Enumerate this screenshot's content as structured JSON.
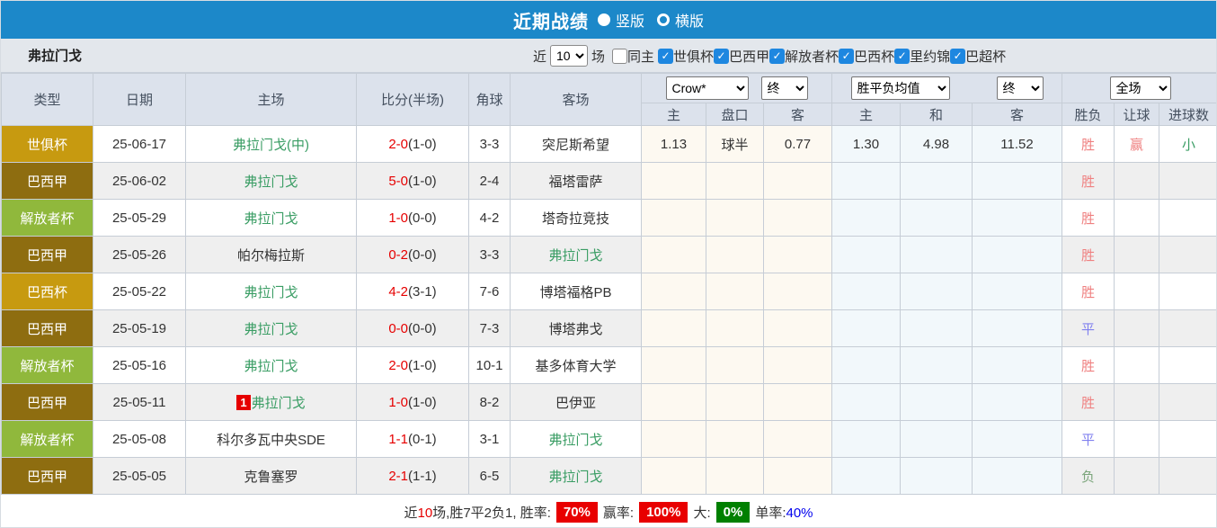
{
  "title_bar": {
    "title": "近期战绩",
    "radio_options": [
      {
        "label": "竖版",
        "selected": true
      },
      {
        "label": "横版",
        "selected": false
      }
    ]
  },
  "filter_bar": {
    "team": "弗拉门戈",
    "near_label": "近",
    "matches_value": "10",
    "matches_label": "场",
    "checkboxes": [
      {
        "label": "同主",
        "checked": false
      },
      {
        "label": "世俱杯",
        "checked": true
      },
      {
        "label": "巴西甲",
        "checked": true
      },
      {
        "label": "解放者杯",
        "checked": true
      },
      {
        "label": "巴西杯",
        "checked": true
      },
      {
        "label": "里约锦",
        "checked": true
      },
      {
        "label": "巴超杯",
        "checked": true
      }
    ]
  },
  "table": {
    "left_headers": [
      "类型",
      "日期",
      "主场",
      "比分(半场)",
      "角球",
      "客场"
    ],
    "dropdowns": {
      "odds_company": "Crow*",
      "odds_stage": "终",
      "avg_type": "胜平负均值",
      "avg_stage": "终",
      "scope": "全场"
    },
    "sub_headers": [
      "主",
      "盘口",
      "客",
      "主",
      "和",
      "客",
      "胜负",
      "让球",
      "进球数"
    ],
    "rows": [
      {
        "type": "世俱杯",
        "date": "25-06-17",
        "home": "弗拉门戈(中)",
        "home_is_team": true,
        "home_rank": "",
        "score": "2-0",
        "half": "(1-0)",
        "corner": "3-3",
        "away": "突尼斯希望",
        "away_is_team": false,
        "odds_home": "1.13",
        "handicap": "球半",
        "odds_away": "0.77",
        "avg_home": "1.30",
        "avg_draw": "4.98",
        "avg_away": "11.52",
        "result": "胜",
        "handicap_result": "赢",
        "goals_result": "小"
      },
      {
        "type": "巴西甲",
        "date": "25-06-02",
        "home": "弗拉门戈",
        "home_is_team": true,
        "home_rank": "",
        "score": "5-0",
        "half": "(1-0)",
        "corner": "2-4",
        "away": "福塔雷萨",
        "away_is_team": false,
        "odds_home": "",
        "handicap": "",
        "odds_away": "",
        "avg_home": "",
        "avg_draw": "",
        "avg_away": "",
        "result": "胜",
        "handicap_result": "",
        "goals_result": ""
      },
      {
        "type": "解放者杯",
        "date": "25-05-29",
        "home": "弗拉门戈",
        "home_is_team": true,
        "home_rank": "",
        "score": "1-0",
        "half": "(0-0)",
        "corner": "4-2",
        "away": "塔奇拉竞技",
        "away_is_team": false,
        "odds_home": "",
        "handicap": "",
        "odds_away": "",
        "avg_home": "",
        "avg_draw": "",
        "avg_away": "",
        "result": "胜",
        "handicap_result": "",
        "goals_result": ""
      },
      {
        "type": "巴西甲",
        "date": "25-05-26",
        "home": "帕尔梅拉斯",
        "home_is_team": false,
        "home_rank": "",
        "score": "0-2",
        "half": "(0-0)",
        "corner": "3-3",
        "away": "弗拉门戈",
        "away_is_team": true,
        "odds_home": "",
        "handicap": "",
        "odds_away": "",
        "avg_home": "",
        "avg_draw": "",
        "avg_away": "",
        "result": "胜",
        "handicap_result": "",
        "goals_result": ""
      },
      {
        "type": "巴西杯",
        "date": "25-05-22",
        "home": "弗拉门戈",
        "home_is_team": true,
        "home_rank": "",
        "score": "4-2",
        "half": "(3-1)",
        "corner": "7-6",
        "away": "博塔福格PB",
        "away_is_team": false,
        "odds_home": "",
        "handicap": "",
        "odds_away": "",
        "avg_home": "",
        "avg_draw": "",
        "avg_away": "",
        "result": "胜",
        "handicap_result": "",
        "goals_result": ""
      },
      {
        "type": "巴西甲",
        "date": "25-05-19",
        "home": "弗拉门戈",
        "home_is_team": true,
        "home_rank": "",
        "score": "0-0",
        "half": "(0-0)",
        "corner": "7-3",
        "away": "博塔弗戈",
        "away_is_team": false,
        "odds_home": "",
        "handicap": "",
        "odds_away": "",
        "avg_home": "",
        "avg_draw": "",
        "avg_away": "",
        "result": "平",
        "handicap_result": "",
        "goals_result": ""
      },
      {
        "type": "解放者杯",
        "date": "25-05-16",
        "home": "弗拉门戈",
        "home_is_team": true,
        "home_rank": "",
        "score": "2-0",
        "half": "(1-0)",
        "corner": "10-1",
        "away": "基多体育大学",
        "away_is_team": false,
        "odds_home": "",
        "handicap": "",
        "odds_away": "",
        "avg_home": "",
        "avg_draw": "",
        "avg_away": "",
        "result": "胜",
        "handicap_result": "",
        "goals_result": ""
      },
      {
        "type": "巴西甲",
        "date": "25-05-11",
        "home": "弗拉门戈",
        "home_is_team": true,
        "home_rank": "1",
        "score": "1-0",
        "half": "(1-0)",
        "corner": "8-2",
        "away": "巴伊亚",
        "away_is_team": false,
        "odds_home": "",
        "handicap": "",
        "odds_away": "",
        "avg_home": "",
        "avg_draw": "",
        "avg_away": "",
        "result": "胜",
        "handicap_result": "",
        "goals_result": ""
      },
      {
        "type": "解放者杯",
        "date": "25-05-08",
        "home": "科尔多瓦中央SDE",
        "home_is_team": false,
        "home_rank": "",
        "score": "1-1",
        "half": "(0-1)",
        "corner": "3-1",
        "away": "弗拉门戈",
        "away_is_team": true,
        "odds_home": "",
        "handicap": "",
        "odds_away": "",
        "avg_home": "",
        "avg_draw": "",
        "avg_away": "",
        "result": "平",
        "handicap_result": "",
        "goals_result": ""
      },
      {
        "type": "巴西甲",
        "date": "25-05-05",
        "home": "克鲁塞罗",
        "home_is_team": false,
        "home_rank": "",
        "score": "2-1",
        "half": "(1-1)",
        "corner": "6-5",
        "away": "弗拉门戈",
        "away_is_team": true,
        "odds_home": "",
        "handicap": "",
        "odds_away": "",
        "avg_home": "",
        "avg_draw": "",
        "avg_away": "",
        "result": "负",
        "handicap_result": "",
        "goals_result": ""
      }
    ]
  },
  "summary": {
    "prefix": "近",
    "count": "10",
    "middle": "场,胜7平2负1, 胜率:",
    "win_rate": "70%",
    "handicap_label": "赢率:",
    "handicap_rate": "100%",
    "big_label": "大:",
    "big_rate": "0%",
    "single_label": "单率:",
    "single_rate": "40%"
  },
  "colors": {
    "header_blue": "#1c88c9",
    "type_badges": {
      "世俱杯": "#c79a10",
      "巴西甲": "#8e6d10",
      "解放者杯": "#90b83c",
      "巴西杯": "#c79a10"
    },
    "team_green": "#3a9d64",
    "score_red": "#e60000",
    "result": {
      "胜": "#ef8080",
      "平": "#8080ef",
      "负": "#7ba57b"
    },
    "handicap_win": "#ef8080",
    "goals_small": "#3a9d64",
    "rate_red": "#e80000",
    "rate_green": "#008000",
    "rate_blue": "#0000ee"
  }
}
